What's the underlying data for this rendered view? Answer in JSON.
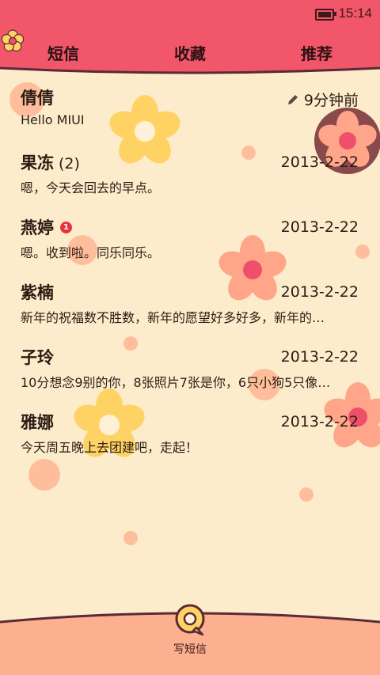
{
  "status": {
    "time": "15:14",
    "battery_level": 1.0
  },
  "tabs": [
    {
      "label": "短信"
    },
    {
      "label": "收藏"
    },
    {
      "label": "推荐"
    }
  ],
  "conversations": [
    {
      "name": "倩倩",
      "count": "",
      "badge": "",
      "date": "9分钟前",
      "preview": "Hello MIUI",
      "draft": true
    },
    {
      "name": "果冻",
      "count": "(2)",
      "badge": "",
      "date": "2013-2-22",
      "preview": "嗯，今天会回去的早点。",
      "draft": false
    },
    {
      "name": "燕婷",
      "count": "",
      "badge": "1",
      "date": "2013-2-22",
      "preview": "嗯。收到啦。同乐同乐。",
      "draft": false
    },
    {
      "name": "紫楠",
      "count": "",
      "badge": "",
      "date": "2013-2-22",
      "preview": "新年的祝福数不胜数，新年的愿望好多好多，新年的…",
      "draft": false
    },
    {
      "name": "子玲",
      "count": "",
      "badge": "",
      "date": "2013-2-22",
      "preview": "10分想念9别的你，8张照片7张是你，6只小狗5只像…",
      "draft": false
    },
    {
      "name": "雅娜",
      "count": "",
      "badge": "",
      "date": "2013-2-22",
      "preview": "今天周五晚上去团建吧，走起！",
      "draft": false
    }
  ],
  "compose": {
    "label": "写短信"
  },
  "colors": {
    "header": "#f2566a",
    "background": "#fdeccc",
    "footer": "#fdb08f",
    "accent": "#5a2a36"
  }
}
